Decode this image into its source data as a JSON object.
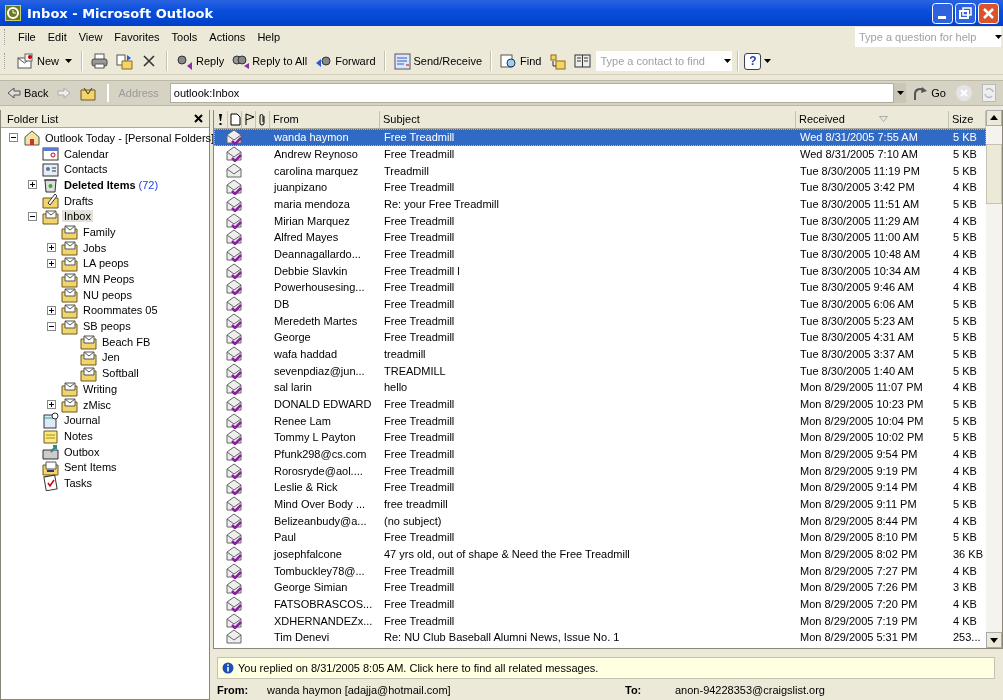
{
  "window": {
    "title": "Inbox - Microsoft Outlook"
  },
  "menu": [
    "File",
    "Edit",
    "View",
    "Favorites",
    "Tools",
    "Actions",
    "Help"
  ],
  "help_search": {
    "placeholder": "Type a question for help"
  },
  "toolbar": [
    {
      "kind": "new",
      "label": "New"
    },
    {
      "kind": "print"
    },
    {
      "kind": "move"
    },
    {
      "kind": "delete"
    },
    {
      "kind": "reply",
      "label": "Reply"
    },
    {
      "kind": "reply_all",
      "label": "Reply to All"
    },
    {
      "kind": "forward",
      "label": "Forward"
    },
    {
      "kind": "send_receive",
      "label": "Send/Receive"
    },
    {
      "kind": "find",
      "label": "Find"
    },
    {
      "kind": "organize"
    },
    {
      "kind": "address_book"
    },
    {
      "kind": "contact_field",
      "placeholder": "Type a contact to find"
    },
    {
      "kind": "help",
      "label": "?"
    }
  ],
  "address_bar": {
    "back": "Back",
    "label": "Address",
    "value": "outlook:Inbox",
    "go": "Go"
  },
  "folder_pane": {
    "title": "Folder List",
    "folders": [
      {
        "name": "Outlook Today - [Personal Folders]",
        "kind": "today",
        "expanded": true,
        "selected": false,
        "children": [
          {
            "name": "Calendar",
            "kind": "calendar",
            "selected": false
          },
          {
            "name": "Contacts",
            "kind": "contacts",
            "selected": false
          },
          {
            "name": "Deleted Items",
            "kind": "deleted",
            "expanded": false,
            "count": "(72)",
            "selected": false
          },
          {
            "name": "Drafts",
            "kind": "drafts",
            "selected": false
          },
          {
            "name": "Inbox",
            "kind": "inbox",
            "expanded": true,
            "selected": true,
            "children": [
              {
                "name": "Family",
                "kind": "folder",
                "selected": false
              },
              {
                "name": "Jobs",
                "kind": "folder",
                "expanded": false,
                "selected": false
              },
              {
                "name": "LA peops",
                "kind": "folder",
                "expanded": false,
                "selected": false
              },
              {
                "name": "MN Peops",
                "kind": "folder",
                "selected": false
              },
              {
                "name": "NU peops",
                "kind": "folder",
                "selected": false
              },
              {
                "name": "Roommates 05",
                "kind": "folder",
                "expanded": false,
                "selected": false
              },
              {
                "name": "SB peops",
                "kind": "folder",
                "expanded": true,
                "selected": false,
                "children": [
                  {
                    "name": "Beach FB",
                    "kind": "folder",
                    "selected": false
                  },
                  {
                    "name": "Jen",
                    "kind": "folder",
                    "selected": false
                  },
                  {
                    "name": "Softball",
                    "kind": "folder",
                    "selected": false
                  }
                ]
              },
              {
                "name": "Writing",
                "kind": "folder",
                "selected": false
              },
              {
                "name": "zMisc",
                "kind": "folder",
                "expanded": false,
                "selected": false
              }
            ]
          },
          {
            "name": "Journal",
            "kind": "journal",
            "selected": false
          },
          {
            "name": "Notes",
            "kind": "notes",
            "selected": false
          },
          {
            "name": "Outbox",
            "kind": "outbox",
            "selected": false
          },
          {
            "name": "Sent Items",
            "kind": "sent",
            "selected": false
          },
          {
            "name": "Tasks",
            "kind": "tasks",
            "selected": false
          }
        ]
      }
    ]
  },
  "message_list": {
    "columns": [
      "From",
      "Subject",
      "Received",
      "Size"
    ],
    "rows": [
      {
        "kind": "replied",
        "selected": true,
        "from": "wanda haymon",
        "subject": "Free Treadmill",
        "received": "Wed 8/31/2005 7:55 AM",
        "size": "5 KB"
      },
      {
        "kind": "replied",
        "selected": false,
        "from": "Andrew Reynoso",
        "subject": "Free Treadmill",
        "received": "Wed 8/31/2005 7:10 AM",
        "size": "5 KB"
      },
      {
        "kind": "read",
        "selected": false,
        "from": "carolina marquez",
        "subject": "Treadmill",
        "received": "Tue 8/30/2005 11:19 PM",
        "size": "5 KB"
      },
      {
        "kind": "replied",
        "selected": false,
        "from": "juanpizano",
        "subject": "Free Treadmill",
        "received": "Tue 8/30/2005 3:42 PM",
        "size": "4 KB"
      },
      {
        "kind": "replied",
        "selected": false,
        "from": "maria mendoza",
        "subject": "Re: your Free Treadmill",
        "received": "Tue 8/30/2005 11:51 AM",
        "size": "5 KB"
      },
      {
        "kind": "replied",
        "selected": false,
        "from": "Mirian Marquez",
        "subject": "Free Treadmill",
        "received": "Tue 8/30/2005 11:29 AM",
        "size": "4 KB"
      },
      {
        "kind": "replied",
        "selected": false,
        "from": "Alfred Mayes",
        "subject": "Free Treadmill",
        "received": "Tue 8/30/2005 11:00 AM",
        "size": "5 KB"
      },
      {
        "kind": "replied",
        "selected": false,
        "from": "Deannagallardo...",
        "subject": "Free Treadmill",
        "received": "Tue 8/30/2005 10:48 AM",
        "size": "4 KB"
      },
      {
        "kind": "replied",
        "selected": false,
        "from": "Debbie Slavkin",
        "subject": "Free Treadmill l",
        "received": "Tue 8/30/2005 10:34 AM",
        "size": "4 KB"
      },
      {
        "kind": "replied",
        "selected": false,
        "from": "Powerhousesing...",
        "subject": "Free Treadmill",
        "received": "Tue 8/30/2005 9:46 AM",
        "size": "4 KB"
      },
      {
        "kind": "replied",
        "selected": false,
        "from": "DB",
        "subject": "Free Treadmill",
        "received": "Tue 8/30/2005 6:06 AM",
        "size": "5 KB"
      },
      {
        "kind": "replied",
        "selected": false,
        "from": "Meredeth Martes",
        "subject": "Free Treadmill",
        "received": "Tue 8/30/2005 5:23 AM",
        "size": "5 KB"
      },
      {
        "kind": "replied",
        "selected": false,
        "from": "George",
        "subject": "Free Treadmill",
        "received": "Tue 8/30/2005 4:31 AM",
        "size": "5 KB"
      },
      {
        "kind": "replied",
        "selected": false,
        "from": "wafa haddad",
        "subject": "treadmill",
        "received": "Tue 8/30/2005 3:37 AM",
        "size": "5 KB"
      },
      {
        "kind": "replied",
        "selected": false,
        "from": "sevenpdiaz@jun...",
        "subject": "TREADMILL",
        "received": "Tue 8/30/2005 1:40 AM",
        "size": "5 KB"
      },
      {
        "kind": "replied",
        "selected": false,
        "from": "sal larin",
        "subject": "hello",
        "received": "Mon 8/29/2005 11:07 PM",
        "size": "4 KB"
      },
      {
        "kind": "replied",
        "selected": false,
        "from": "DONALD EDWARD",
        "subject": "Free Treadmill",
        "received": "Mon 8/29/2005 10:23 PM",
        "size": "5 KB"
      },
      {
        "kind": "replied",
        "selected": false,
        "from": "Renee Lam",
        "subject": "Free Treadmill",
        "received": "Mon 8/29/2005 10:04 PM",
        "size": "5 KB"
      },
      {
        "kind": "replied",
        "selected": false,
        "from": "Tommy L Payton",
        "subject": "Free Treadmill",
        "received": "Mon 8/29/2005 10:02 PM",
        "size": "5 KB"
      },
      {
        "kind": "replied",
        "selected": false,
        "from": "Pfunk298@cs.com",
        "subject": "Free Treadmill",
        "received": "Mon 8/29/2005 9:54 PM",
        "size": "4 KB"
      },
      {
        "kind": "replied",
        "selected": false,
        "from": "Rorosryde@aol....",
        "subject": "Free Treadmill",
        "received": "Mon 8/29/2005 9:19 PM",
        "size": "4 KB"
      },
      {
        "kind": "replied",
        "selected": false,
        "from": "Leslie & Rick",
        "subject": "Free Treadmill",
        "received": "Mon 8/29/2005 9:14 PM",
        "size": "4 KB"
      },
      {
        "kind": "replied",
        "selected": false,
        "from": "Mind Over Body ...",
        "subject": "free treadmill",
        "received": "Mon 8/29/2005 9:11 PM",
        "size": "5 KB"
      },
      {
        "kind": "replied",
        "selected": false,
        "from": "Belizeanbudy@a...",
        "subject": "(no subject)",
        "received": "Mon 8/29/2005 8:44 PM",
        "size": "4 KB"
      },
      {
        "kind": "replied",
        "selected": false,
        "from": "Paul",
        "subject": "Free Treadmill",
        "received": "Mon 8/29/2005 8:10 PM",
        "size": "5 KB"
      },
      {
        "kind": "replied",
        "selected": false,
        "from": "josephfalcone",
        "subject": "47 yrs old, out of shape & Need the Free Treadmill",
        "received": "Mon 8/29/2005 8:02 PM",
        "size": "36 KB"
      },
      {
        "kind": "replied",
        "selected": false,
        "from": "Tombuckley78@...",
        "subject": "Free Treadmill",
        "received": "Mon 8/29/2005 7:27 PM",
        "size": "4 KB"
      },
      {
        "kind": "replied",
        "selected": false,
        "from": "George Simian",
        "subject": "Free Treadmill",
        "received": "Mon 8/29/2005 7:26 PM",
        "size": "3 KB"
      },
      {
        "kind": "replied",
        "selected": false,
        "from": "FATSOBRASCOS...",
        "subject": "Free Treadmill",
        "received": "Mon 8/29/2005 7:20 PM",
        "size": "4 KB"
      },
      {
        "kind": "replied",
        "selected": false,
        "from": "XDHERNANDEZx...",
        "subject": "Free Treadmill",
        "received": "Mon 8/29/2005 7:19 PM",
        "size": "4 KB"
      },
      {
        "kind": "read",
        "selected": false,
        "from": "Tim Denevi",
        "subject": "Re: NU Club Baseball Alumni News, Issue No. 1",
        "received": "Mon 8/29/2005 5:31 PM",
        "size": "253..."
      }
    ]
  },
  "preview": {
    "info": "You replied on 8/31/2005 8:05 AM. Click here to find all related messages.",
    "from_label": "From:",
    "from": "wanda haymon [adajja@hotmail.com]",
    "to_label": "To:",
    "to": "anon-94228353@craigslist.org"
  }
}
